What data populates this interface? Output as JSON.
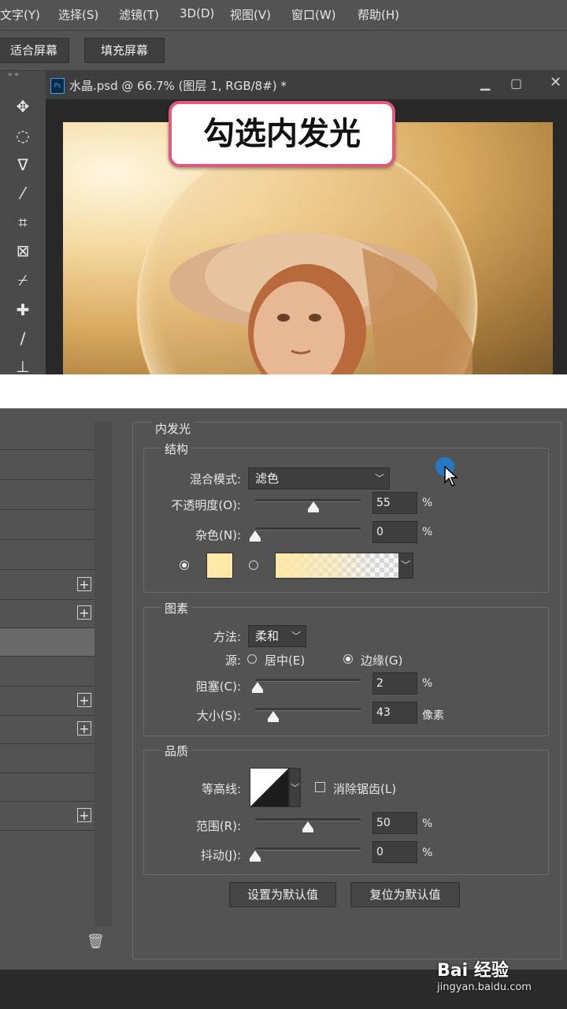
{
  "menu": [
    "文字(Y)",
    "选择(S)",
    "滤镜(T)",
    "3D(D)",
    "视图(V)",
    "窗口(W)",
    "帮助(H)"
  ],
  "options_bar": {
    "fit_screen": "适合屏幕",
    "fill_screen": "填充屏幕"
  },
  "document": {
    "tab_title": "水晶.psd @ 66.7% (图层 1, RGB/8#) *",
    "ps_badge": "Ps"
  },
  "callout": "勾选内发光",
  "panel": {
    "title": "内发光",
    "structure": {
      "title": "结构",
      "blend_mode_label": "混合模式:",
      "blend_mode_value": "滤色",
      "opacity_label": "不透明度(O):",
      "opacity_value": "55",
      "opacity_level": 0.55,
      "opacity_unit": "%",
      "noise_label": "杂色(N):",
      "noise_value": "0",
      "noise_level": 0,
      "noise_unit": "%",
      "glow_color": "#fde8a8"
    },
    "elements": {
      "title": "图素",
      "method_label": "方法:",
      "method_value": "柔和",
      "source_label": "源:",
      "source_center": "居中(E)",
      "source_edge": "边缘(G)",
      "choke_label": "阻塞(C):",
      "choke_value": "2",
      "choke_level": 0.02,
      "choke_unit": "%",
      "size_label": "大小(S):",
      "size_value": "43",
      "size_level": 0.17,
      "size_unit": "像素"
    },
    "quality": {
      "title": "品质",
      "contour_label": "等高线:",
      "antialias_label": "消除锯齿(L)",
      "range_label": "范围(R):",
      "range_value": "50",
      "range_level": 0.5,
      "range_unit": "%",
      "jitter_label": "抖动(J):",
      "jitter_value": "0",
      "jitter_level": 0,
      "jitter_unit": "%"
    },
    "buttons": {
      "set_default": "设置为默认值",
      "reset_default": "复位为默认值"
    }
  },
  "watermark": {
    "brand": "Bai 经验",
    "url": "jingyan.baidu.com"
  },
  "icons": [
    "move-icon",
    "marquee-icon",
    "lasso-icon",
    "magic-wand-icon",
    "crop-icon",
    "frame-icon",
    "eyedropper-icon",
    "healing-icon",
    "brush-icon",
    "stamp-icon",
    "trash-icon",
    "plus-icon"
  ]
}
